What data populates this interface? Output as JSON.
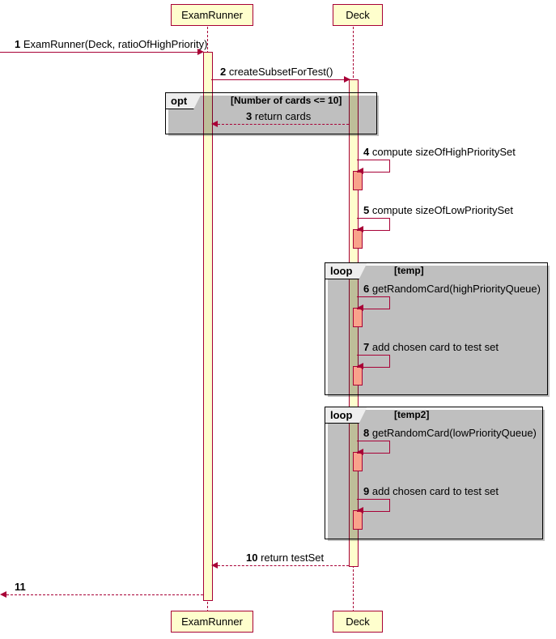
{
  "participants": {
    "examRunner": "ExamRunner",
    "deck": "Deck"
  },
  "messages": {
    "m1": {
      "num": "1",
      "text": "ExamRunner(Deck, ratioOfHighPriority)"
    },
    "m2": {
      "num": "2",
      "text": "createSubsetForTest()"
    },
    "m3": {
      "num": "3",
      "text": "return cards"
    },
    "m4": {
      "num": "4",
      "text": "compute sizeOfHighPrioritySet"
    },
    "m5": {
      "num": "5",
      "text": "compute sizeOfLowPriorityset"
    },
    "m6": {
      "num": "6",
      "text": "getRandomCard(highPriorityQueue)"
    },
    "m7": {
      "num": "7",
      "text": "add chosen card to test set"
    },
    "m8": {
      "num": "8",
      "text": "getRandomCard(lowPriorityQueue)"
    },
    "m9": {
      "num": "9",
      "text": "add chosen card to test set"
    },
    "m10": {
      "num": "10",
      "text": "return testSet"
    },
    "m11": {
      "num": "11",
      "text": ""
    }
  },
  "messages_corrected": {
    "m5text": "compute sizeOfLowPrioritySet"
  },
  "frames": {
    "opt": {
      "label": "opt",
      "guard": "[Number of cards <= 10]"
    },
    "loop1": {
      "label": "loop",
      "guard": "[temp]"
    },
    "loop2": {
      "label": "loop",
      "guard": "[temp2]"
    }
  },
  "chart_data": {
    "type": "sequence-diagram",
    "participants": [
      "ExamRunner",
      "Deck"
    ],
    "interactions": [
      {
        "n": 1,
        "from": "external",
        "to": "ExamRunner",
        "kind": "sync",
        "label": "ExamRunner(Deck, ratioOfHighPriority)"
      },
      {
        "n": 2,
        "from": "ExamRunner",
        "to": "Deck",
        "kind": "sync",
        "label": "createSubsetForTest()"
      },
      {
        "frame": "opt",
        "guard": "Number of cards <= 10",
        "contents": [
          {
            "n": 3,
            "from": "Deck",
            "to": "ExamRunner",
            "kind": "return",
            "label": "return cards"
          }
        ]
      },
      {
        "n": 4,
        "from": "Deck",
        "to": "Deck",
        "kind": "self",
        "label": "compute sizeOfHighPrioritySet"
      },
      {
        "n": 5,
        "from": "Deck",
        "to": "Deck",
        "kind": "self",
        "label": "compute sizeOfLowPrioritySet"
      },
      {
        "frame": "loop",
        "guard": "temp",
        "contents": [
          {
            "n": 6,
            "from": "Deck",
            "to": "Deck",
            "kind": "self",
            "label": "getRandomCard(highPriorityQueue)"
          },
          {
            "n": 7,
            "from": "Deck",
            "to": "Deck",
            "kind": "self",
            "label": "add chosen card to test set"
          }
        ]
      },
      {
        "frame": "loop",
        "guard": "temp2",
        "contents": [
          {
            "n": 8,
            "from": "Deck",
            "to": "Deck",
            "kind": "self",
            "label": "getRandomCard(lowPriorityQueue)"
          },
          {
            "n": 9,
            "from": "Deck",
            "to": "Deck",
            "kind": "self",
            "label": "add chosen card to test set"
          }
        ]
      },
      {
        "n": 10,
        "from": "Deck",
        "to": "ExamRunner",
        "kind": "return",
        "label": "return testSet"
      },
      {
        "n": 11,
        "from": "ExamRunner",
        "to": "external",
        "kind": "return",
        "label": ""
      }
    ]
  }
}
